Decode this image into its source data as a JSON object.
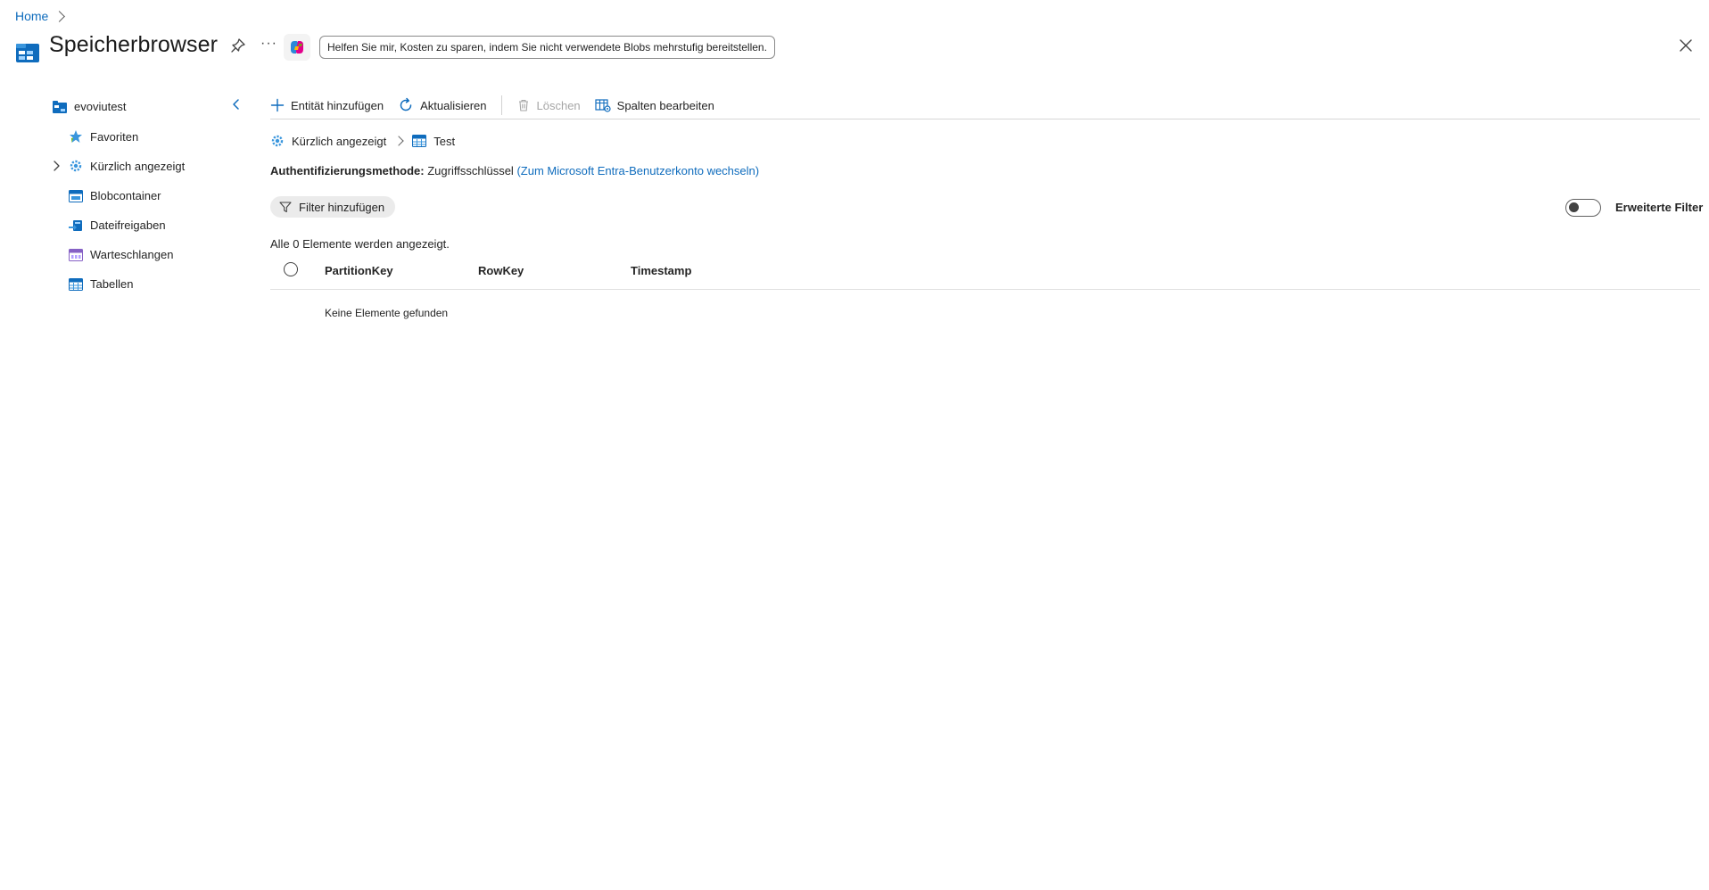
{
  "breadcrumb": {
    "home": "Home"
  },
  "header": {
    "title": "Speicherbrowser",
    "copilot_suggestion": "Helfen Sie mir, Kosten zu sparen, indem Sie nicht verwendete Blobs mehrstufig bereitstellen.",
    "more": "···"
  },
  "sidebar": {
    "account": "evoviutest",
    "items": [
      {
        "label": "Favoriten",
        "icon": "star-icon"
      },
      {
        "label": "Kürzlich angezeigt",
        "icon": "gear-recent-icon"
      },
      {
        "label": "Blobcontainer",
        "icon": "blob-container-icon"
      },
      {
        "label": "Dateifreigaben",
        "icon": "file-share-icon"
      },
      {
        "label": "Warteschlangen",
        "icon": "queue-icon"
      },
      {
        "label": "Tabellen",
        "icon": "table-icon"
      }
    ]
  },
  "toolbar": {
    "add_entity": "Entität hinzufügen",
    "refresh": "Aktualisieren",
    "delete": "Löschen",
    "edit_columns": "Spalten bearbeiten"
  },
  "path": {
    "recent": "Kürzlich angezeigt",
    "current": "Test"
  },
  "auth": {
    "label": "Authentifizierungsmethode:",
    "value": "Zugriffsschlüssel",
    "switch_link": "(Zum Microsoft Entra-Benutzerkonto wechseln)"
  },
  "filter": {
    "add_label": "Filter hinzufügen",
    "advanced_label": "Erweiterte Filter",
    "advanced_on": false
  },
  "table": {
    "count_text": "Alle 0 Elemente werden angezeigt.",
    "columns": [
      "PartitionKey",
      "RowKey",
      "Timestamp"
    ],
    "empty_text": "Keine Elemente gefunden"
  },
  "colors": {
    "accent": "#0f6cbd",
    "text": "#242424"
  }
}
